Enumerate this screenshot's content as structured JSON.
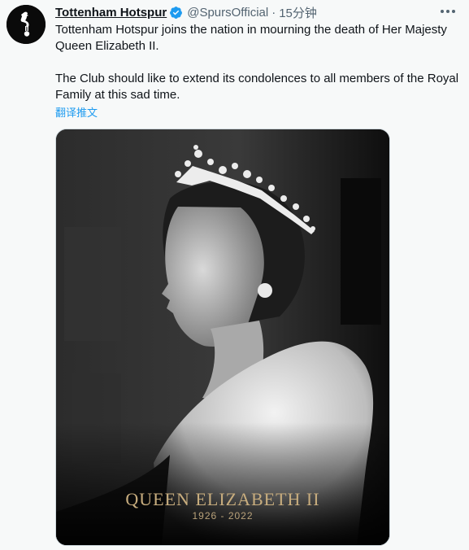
{
  "account": {
    "display_name": "Tottenham Hotspur",
    "handle": "@SpursOfficial",
    "separator": "·",
    "time": "15分钟",
    "avatar_icon": "cockerel-icon",
    "verified_icon": "verified-badge-icon"
  },
  "tweet": {
    "paragraphs": [
      "Tottenham Hotspur joins the nation in mourning the death of Her Majesty Queen Elizabeth II.",
      "The Club should like to extend its condolences to all members of the Royal Family at this sad time."
    ],
    "translate_label": "翻译推文"
  },
  "media": {
    "title": "QUEEN ELIZABETH II",
    "years": "1926 - 2022"
  },
  "colors": {
    "link": "#1d9bf0",
    "verified": "#1d9bf0",
    "secondary_text": "#536471",
    "caption_gold": "#c8ad7e"
  }
}
